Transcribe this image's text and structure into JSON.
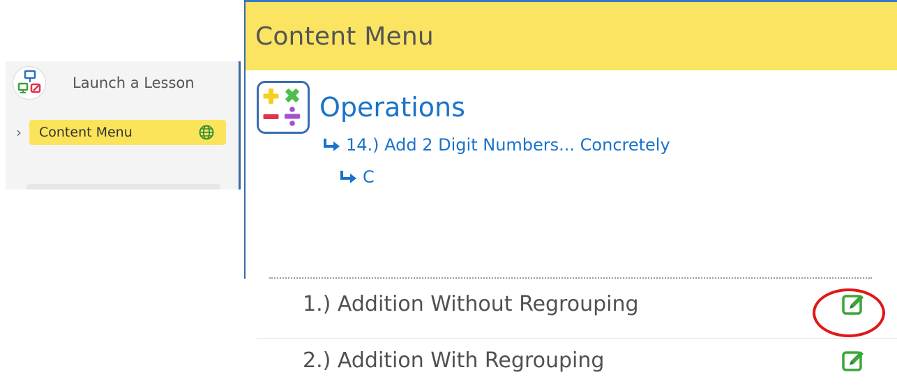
{
  "sidebar": {
    "launch": {
      "label": "Launch a Lesson",
      "icon": "launch-lesson-icon"
    },
    "content_menu": {
      "label": "Content Menu",
      "icon": "globe-icon",
      "highlight_color": "#fce45a"
    }
  },
  "panel": {
    "title": "Content Menu",
    "header_color": "#fbe462",
    "category": {
      "icon": "operations-icon",
      "title": "Operations"
    },
    "breadcrumb": {
      "lesson": "14.) Add 2 Digit Numbers... Concretely",
      "sub": "C"
    },
    "lessons": [
      {
        "label": "1.) Addition Without Regrouping",
        "icon": "edit-icon",
        "annotated": true
      },
      {
        "label": "2.) Addition With Regrouping",
        "icon": "edit-icon",
        "annotated": false
      }
    ],
    "accent_color": "#1a73c9",
    "annotation_color": "#e01818"
  }
}
